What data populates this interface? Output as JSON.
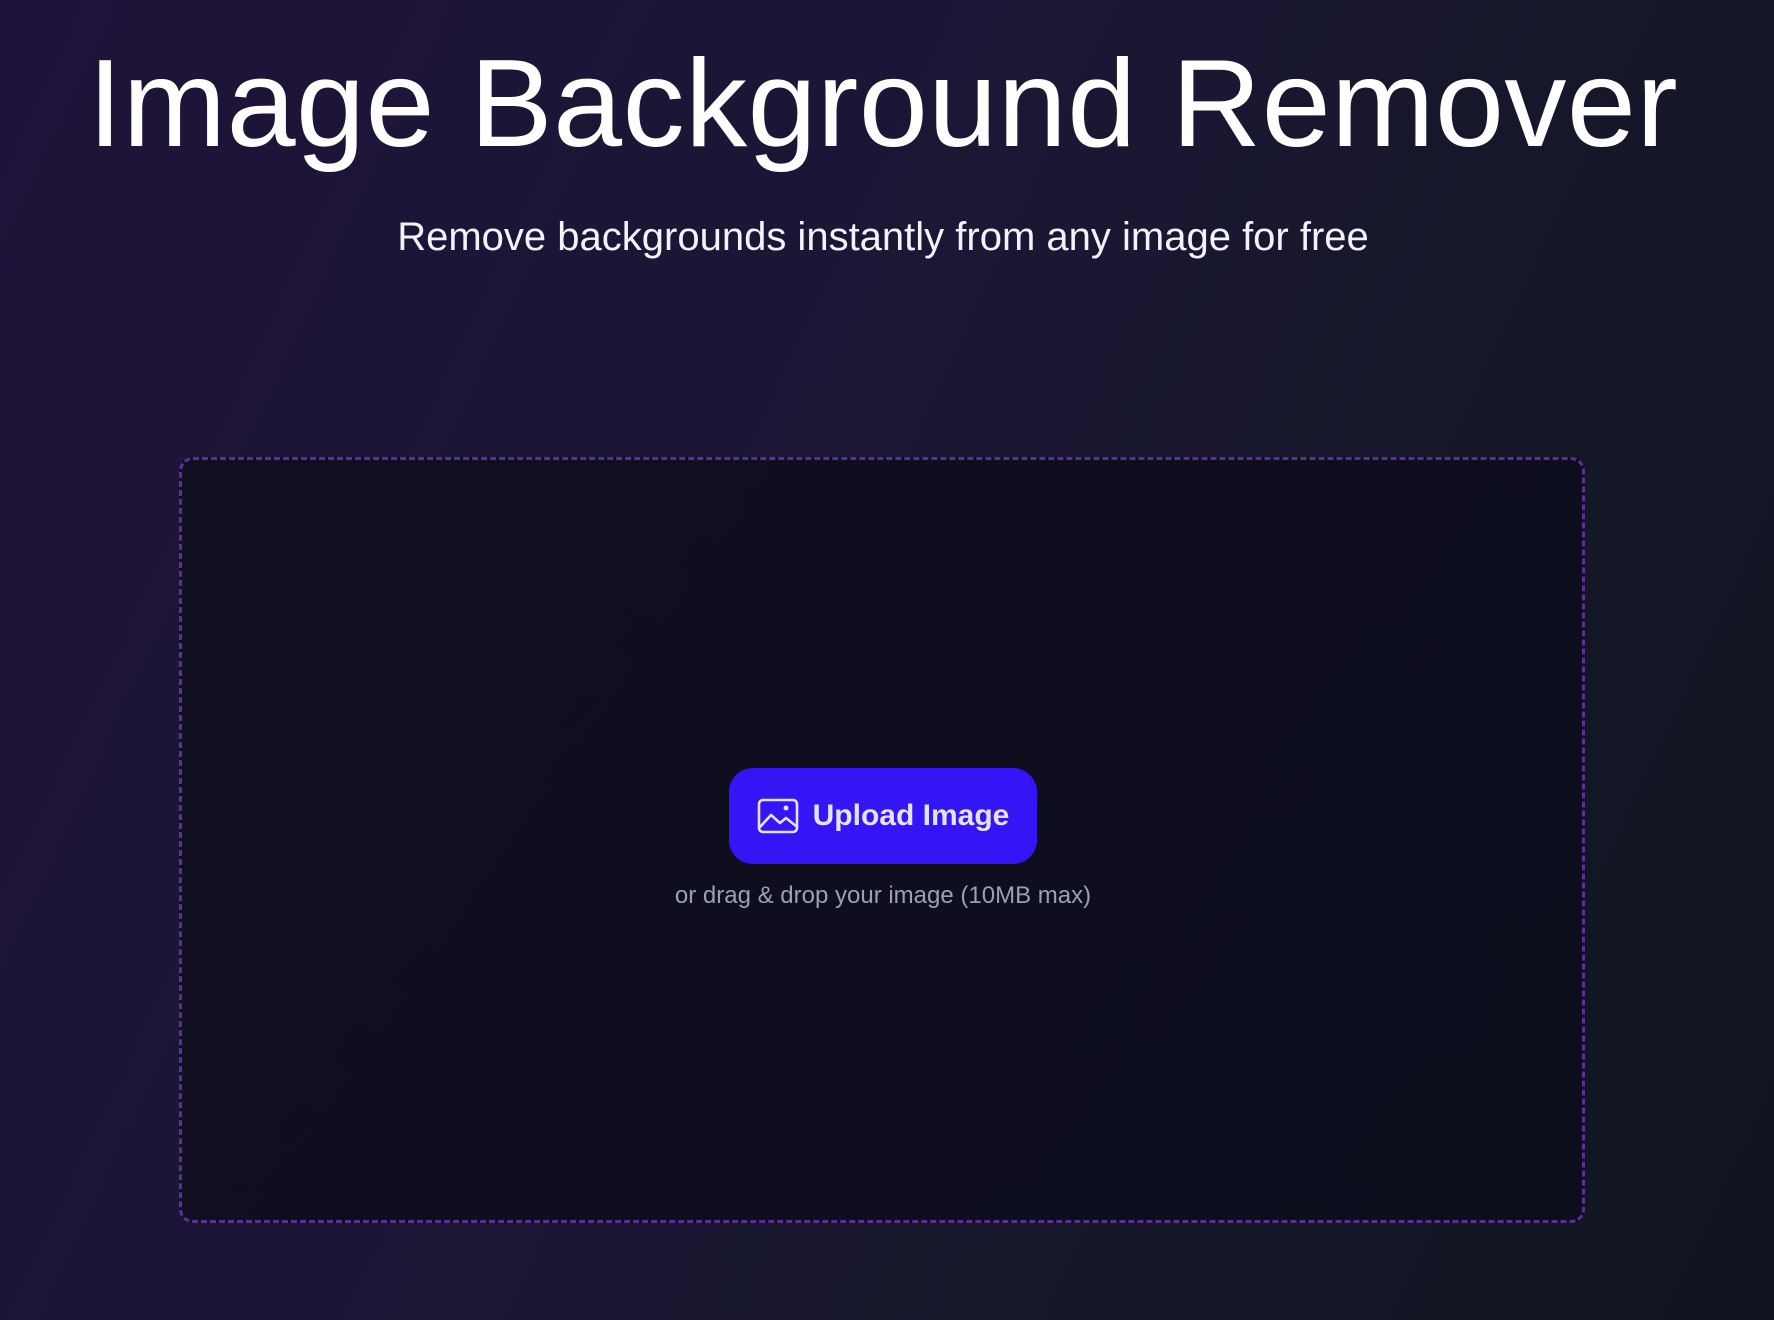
{
  "header": {
    "title": "Image Background Remover",
    "subtitle": "Remove backgrounds instantly from any image for free"
  },
  "upload": {
    "button_label": "Upload Image",
    "button_icon": "image-icon",
    "hint": "or drag & drop your image (10MB max)"
  },
  "colors": {
    "button_background": "#3514f5",
    "dropzone_border": "#5b2f96",
    "hint_text": "#9aa0b4"
  }
}
